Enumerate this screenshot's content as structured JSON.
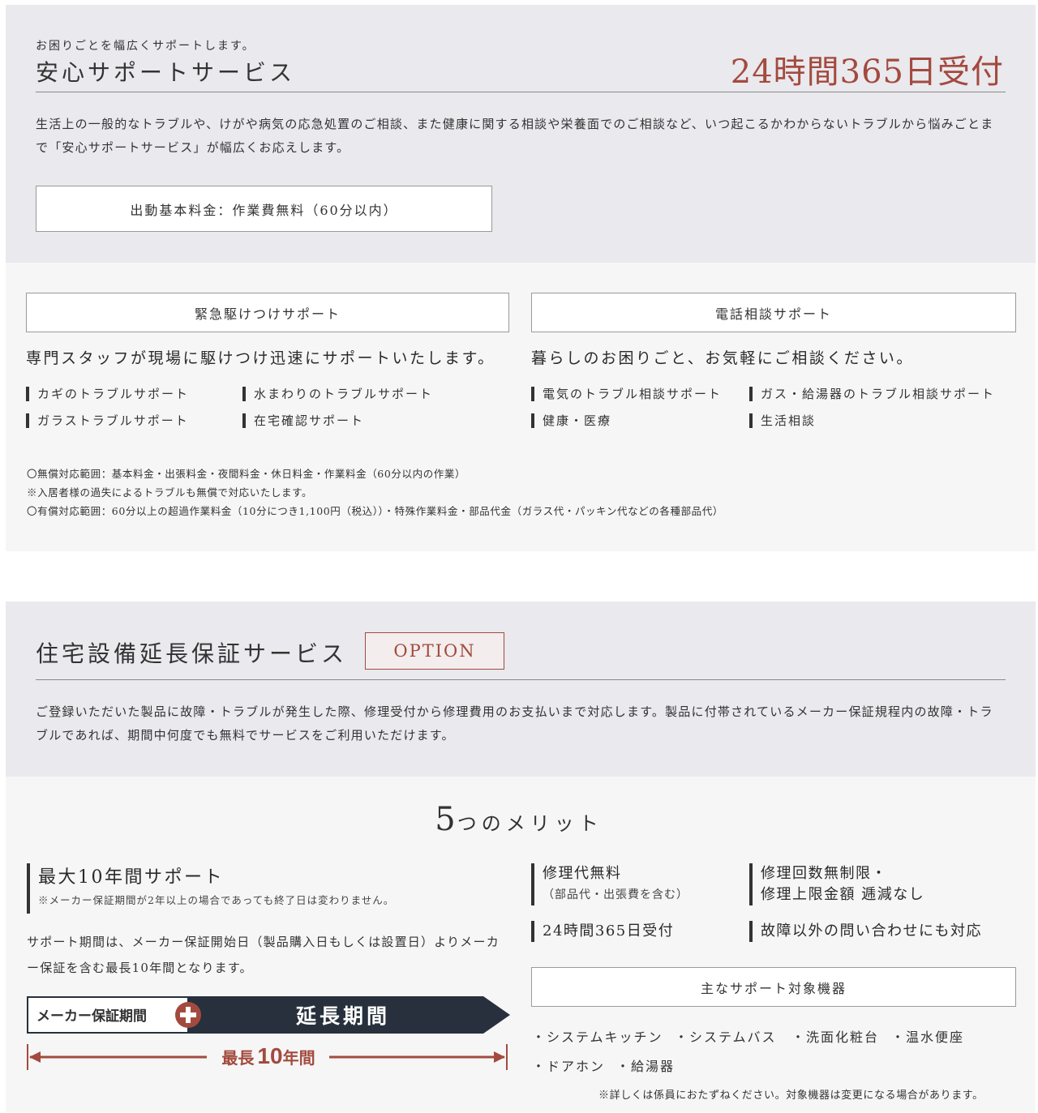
{
  "support": {
    "subtitle": "お困りごとを幅広くサポートします。",
    "title": "安心サポートサービス",
    "accent": "24時間365日受付",
    "description": "生活上の一般的なトラブルや、けがや病気の応急処置のご相談、また健康に関する相談や栄養面でのご相談など、いつ起こるかわからないトラブルから悩みごとまで「安心サポートサービス」が幅広くお応えします。",
    "fee_box": "出動基本料金：作業費無料（60分以内）",
    "emergency": {
      "heading": "緊急駆けつけサポート",
      "lead": "専門スタッフが現場に駆けつけ迅速にサポートいたします。",
      "items": [
        "カギのトラブルサポート",
        "水まわりのトラブルサポート",
        "ガラストラブルサポート",
        "在宅確認サポート"
      ]
    },
    "phone": {
      "heading": "電話相談サポート",
      "lead": "暮らしのお困りごと、お気軽にご相談ください。",
      "items": [
        "電気のトラブル相談サポート",
        "ガス・給湯器のトラブル相談サポート",
        "健康・医療",
        "生活相談"
      ]
    },
    "notes": [
      "〇無償対応範囲：基本料金・出張料金・夜間料金・休日料金・作業料金（60分以内の作業）",
      "※入居者様の過失によるトラブルも無償で対応いたします。",
      "〇有償対応範囲：60分以上の超過作業料金（10分につき1,100円（税込））・特殊作業料金・部品代金（ガラス代・パッキン代などの各種部品代）"
    ]
  },
  "warranty": {
    "title": "住宅設備延長保証サービス",
    "badge": "OPTION",
    "description": "ご登録いただいた製品に故障・トラブルが発生した際、修理受付から修理費用のお支払いまで対応します。製品に付帯されているメーカー保証規程内の故障・トラブルであれば、期間中何度でも無料でサービスをご利用いただけます。",
    "merits_number": "5",
    "merits_suffix": "つのメリット",
    "main_merit": {
      "title": "最大10年間サポート",
      "note": "※メーカー保証期間が2年以上の場合であっても終了日は変わりません。"
    },
    "period_text": "サポート期間は、メーカー保証開始日（製品購入日もしくは設置日）よりメーカー保証を含む最長10年間となります。",
    "diagram": {
      "maker_label": "メーカー保証期間",
      "extended_label": "延長期間",
      "max_label_pre": "最長",
      "max_label_num": "10",
      "max_label_post": "年間"
    },
    "merits": [
      {
        "title": "修理代無料",
        "sub": "（部品代・出張費を含む）"
      },
      {
        "title": "修理回数無制限・",
        "sub2": "修理上限金額 逓減なし"
      },
      {
        "title": "24時間365日受付"
      },
      {
        "title": "故障以外の問い合わせにも対応"
      }
    ],
    "equipment": {
      "heading": "主なサポート対象機器",
      "items": [
        "・システムキッチン",
        "・システムバス",
        "・洗面化粧台",
        "・温水便座",
        "・ドアホン",
        "・給湯器"
      ],
      "note": "※詳しくは係員におたずねください。対象機器は変更になる場合があります。"
    }
  },
  "colors": {
    "accent": "#a34a3e",
    "navy": "#27303c",
    "panel_gray": "#e9e9ee",
    "panel_light": "#f6f6f6"
  }
}
